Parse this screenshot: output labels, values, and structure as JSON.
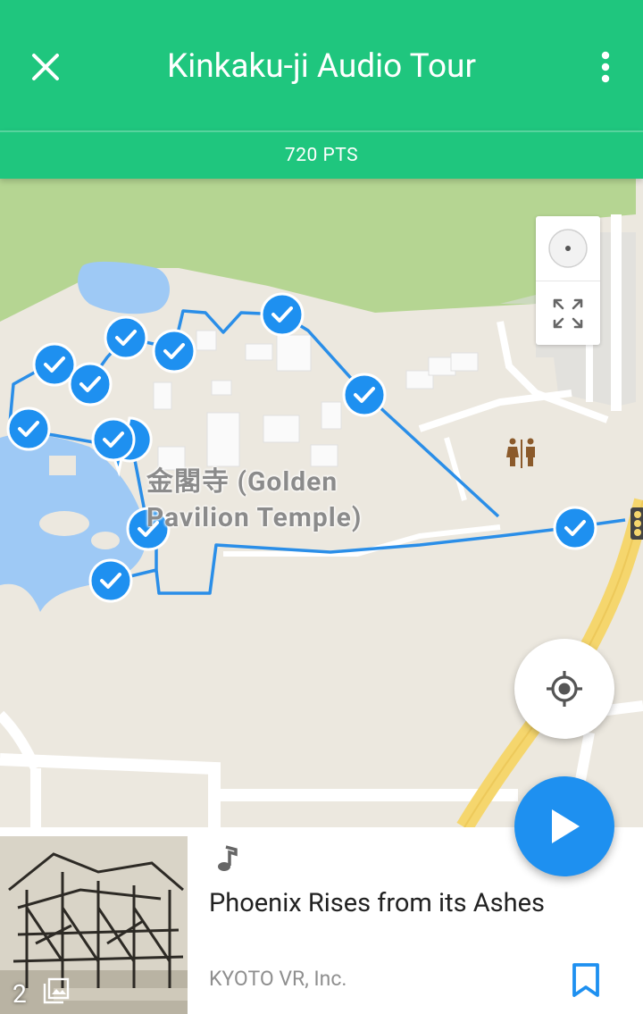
{
  "header": {
    "title": "Kinkaku-ji Audio Tour",
    "points": "720 PTS",
    "close_icon": "close-icon",
    "menu_icon": "more-vert-icon"
  },
  "map": {
    "place_label": "金閣寺 (Golden\nPavilion Temple)",
    "controls": [
      "compass-icon",
      "fullscreen-icon"
    ],
    "locate_icon": "my-location-icon",
    "restroom_icon": "restroom-icon",
    "route_color": "#2a8ee8",
    "marker_color": "#1e90f0"
  },
  "card": {
    "image_count": "2",
    "title": "Phoenix Rises from its Ashes",
    "author": "KYOTO VR, Inc.",
    "play_icon": "play-icon",
    "bookmark_icon": "bookmark-icon",
    "music_icon": "music-note-icon",
    "gallery_icon": "photo-library-icon"
  },
  "colors": {
    "header_bg": "#1fc67e",
    "accent": "#1e90f0"
  }
}
